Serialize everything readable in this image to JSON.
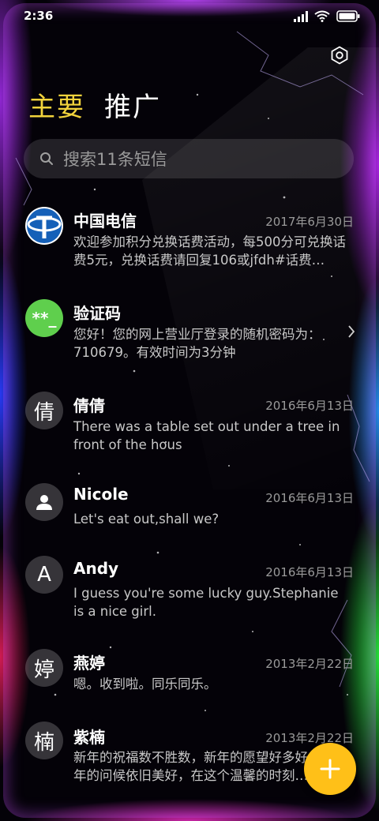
{
  "status_bar": {
    "time": "2:36"
  },
  "tabs": [
    {
      "label": "主要",
      "active": true
    },
    {
      "label": "推广",
      "active": false
    }
  ],
  "search": {
    "placeholder": "搜索11条短信"
  },
  "conversations": [
    {
      "avatar_type": "telecom-logo",
      "name": "中国电信",
      "date": "2017年6月30日",
      "preview": "欢迎参加积分兑换话费活动，每500分可兑换话费5元，兑换话费请回复106或jfdh#话费…"
    },
    {
      "avatar_type": "code",
      "avatar_text": "**_",
      "name": "验证码",
      "date": "",
      "preview": "您好！您的网上营业厅登录的随机密码为：710679。有效时间为3分钟"
    },
    {
      "avatar_type": "letter",
      "avatar_text": "倩",
      "name": "倩倩",
      "date": "2016年6月13日",
      "preview": "There was a table set out under a tree in front of the hous"
    },
    {
      "avatar_type": "person",
      "name": "Nicole",
      "date": "2016年6月13日",
      "preview": "Let's eat out,shall we?"
    },
    {
      "avatar_type": "letter",
      "avatar_text": "A",
      "name": "Andy",
      "date": "2016年6月13日",
      "preview": "I guess you're some lucky guy.Stephanie is a nice girl."
    },
    {
      "avatar_type": "letter",
      "avatar_text": "婷",
      "name": "燕婷",
      "date": "2013年2月22日",
      "preview": "嗯。收到啦。同乐同乐。"
    },
    {
      "avatar_type": "letter",
      "avatar_text": "楠",
      "name": "紫楠",
      "date": "2013年2月22日",
      "preview": "新年的祝福数不胜数，新年的愿望好多好多，新年的问候依旧美好，在这个温馨的时刻…"
    }
  ],
  "colors": {
    "accent": "#f2d33c",
    "fab": "#ffc018",
    "code_avatar": "#5fcf4d"
  },
  "icons": {
    "settings": "gear-icon",
    "search": "search-icon",
    "fab": "plus-icon",
    "chevron": "chevron-right-icon"
  }
}
